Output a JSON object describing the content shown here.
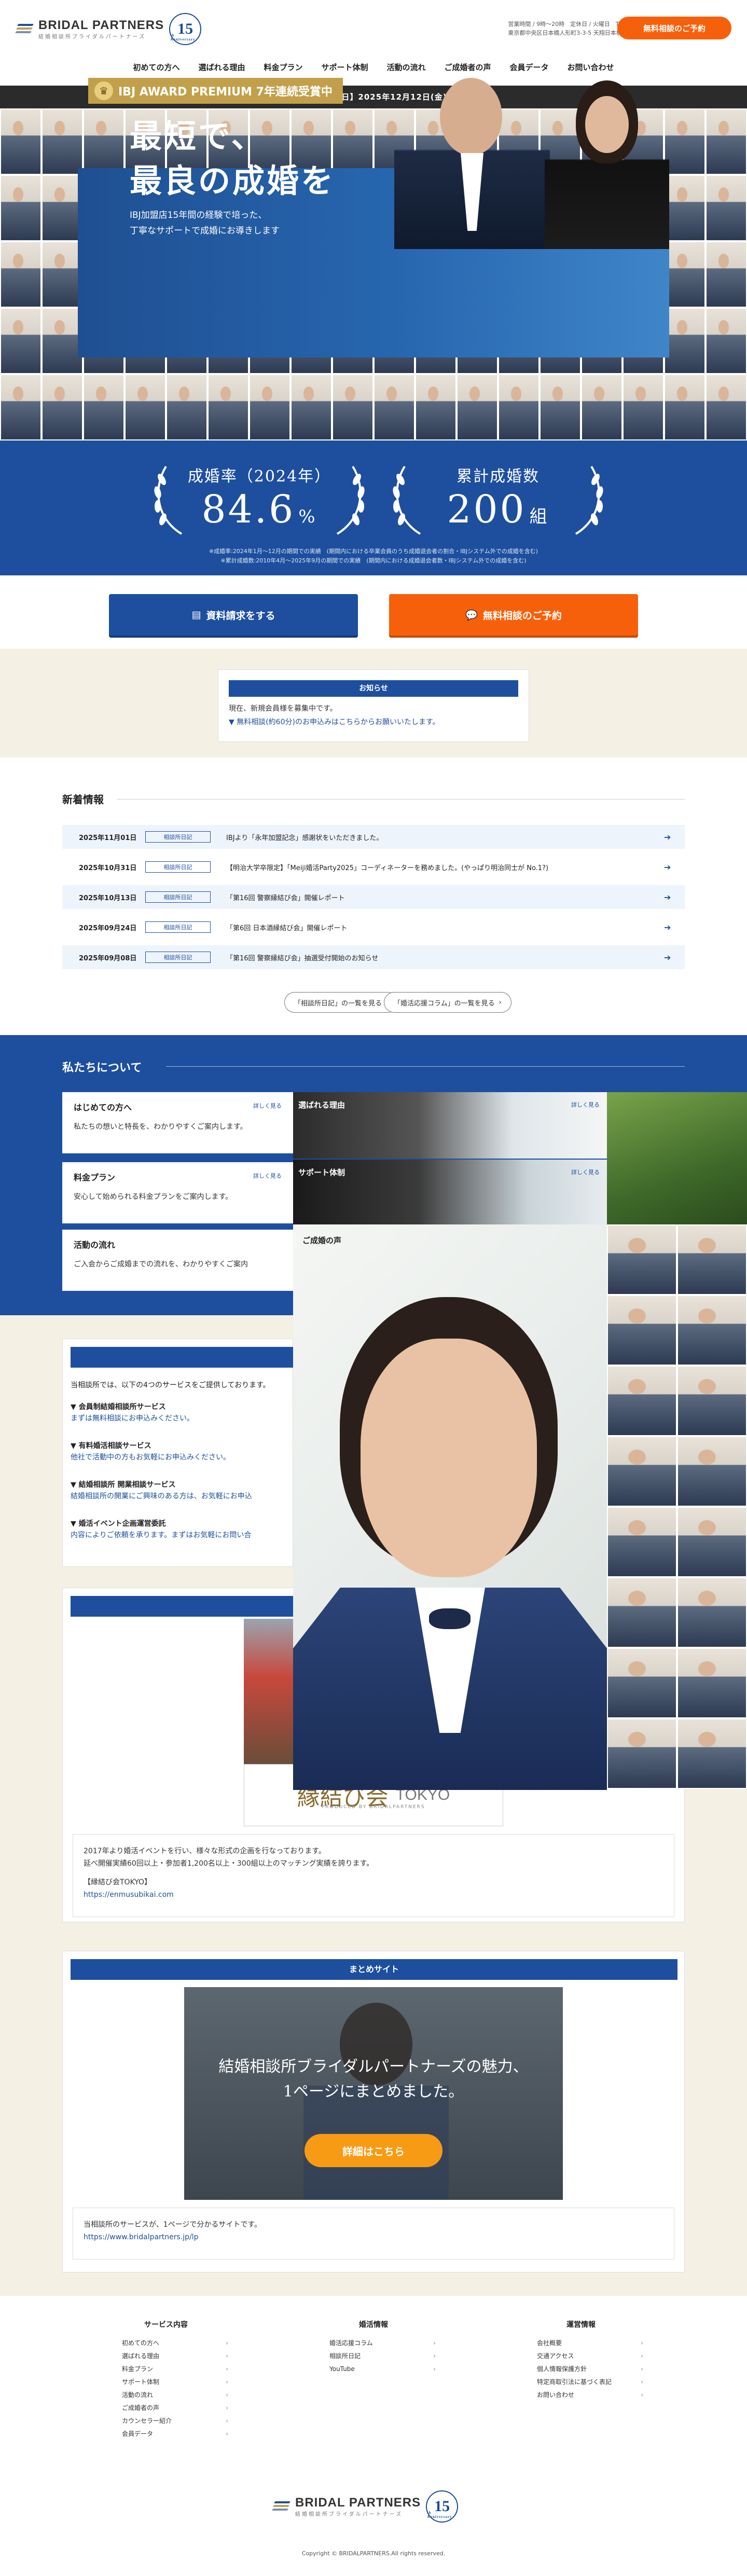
{
  "header": {
    "brand": "BRIDAL PARTNERS",
    "brand_sub": "結婚相談所ブライダルパートナーズ",
    "anniv": "15",
    "anniv_small": "th Anniversary",
    "hours": "営業時間 / 9時〜20時　定休日 / 火曜日　TEL.050-5477-7189",
    "address": "東京都中央区日本橋人形町3-3-5 天翔日本橋人形町ビル2階",
    "cta": "無料相談のご予約"
  },
  "nav": [
    "初めての方へ",
    "選ばれる理由",
    "料金プラン",
    "サポート体制",
    "活動の流れ",
    "ご成婚者の声",
    "会員データ",
    "お問い合わせ"
  ],
  "date_bar": "【最終更新日】2025年12月12日(金)",
  "hero": {
    "award": "IBJ AWARD PREMIUM 7年連続受賞中",
    "copy1": "最短で、",
    "copy2": "最良の成婚を",
    "sub1": "IBJ加盟店15年間の経験で培った、",
    "sub2": "丁寧なサポートで成婚にお導きします"
  },
  "stats": {
    "rate_label": "成婚率（2024年）",
    "rate_value": "84.6",
    "rate_unit": "%",
    "count_label": "累計成婚数",
    "count_value": "200",
    "count_unit": "組",
    "note1": "※成婚率:2024年1月〜12月の期間での実績　(期間内における卒業会員のうち成婚退会者の割合・IBJシステム外での成婚を含む)",
    "note2": "※累計成婚数:2010年4月〜2025年9月の期間での実績　(期間内における成婚退会者数・IBJシステム外での成婚を含む)"
  },
  "cta": {
    "doc": "資料請求をする",
    "consult": "無料相談のご予約"
  },
  "notice": {
    "title": "お知らせ",
    "line1": "現在、新規会員様を募集中です。",
    "line2": "▼ 無料相談(約60分)のお申込みはこちらからお願いいたします。"
  },
  "news": {
    "title": "新着情報",
    "rows": [
      {
        "date": "2025年11月01日",
        "tag": "相談所日記",
        "title": "IBJより「永年加盟記念」感謝状をいただきました。"
      },
      {
        "date": "2025年10月31日",
        "tag": "相談所日記",
        "title": "【明治大学卒限定】「Meiji婚活Party2025」コーディネーターを務めました。(やっぱり明治同士が No.1?)"
      },
      {
        "date": "2025年10月13日",
        "tag": "相談所日記",
        "title": "「第16回 警察縁結び会」開催レポート"
      },
      {
        "date": "2025年09月24日",
        "tag": "相談所日記",
        "title": "「第6回 日本酒縁結び会」開催レポート"
      },
      {
        "date": "2025年09月08日",
        "tag": "相談所日記",
        "title": "「第16回 警察縁結び会」抽選受付開始のお知らせ"
      }
    ],
    "pill1": "「相談所日記」の一覧を見る",
    "pill2": "「婚活応援コラム」の一覧を見る"
  },
  "about": {
    "title": "私たちについて",
    "more": "詳しく見る",
    "cards": [
      {
        "t": "はじめての方へ",
        "d": "私たちの想いと特長を、わかりやすくご案内します。"
      },
      {
        "t": "料金プラン",
        "d": "安心して始められる料金プランをご案内します。"
      },
      {
        "t": "活動の流れ",
        "d": "ご入会からご成婚までの流れを、わかりやすくご案内"
      }
    ],
    "photos": [
      "選ばれる理由",
      "サポート体制",
      "ご成婚の声"
    ]
  },
  "services": {
    "intro": "当相談所では、以下の4つのサービスをご提供しております。",
    "items": [
      {
        "t": "▼ 会員制結婚相談所サービス",
        "d": "まずは無料相談にお申込みください。"
      },
      {
        "t": "▼ 有料婚活相談サービス",
        "d": "他社で活動中の方もお気軽にお申込みください。"
      },
      {
        "t": "▼ 結婚相談所 開業相談サービス",
        "d": "結婚相談所の開業にご興味のある方は、お気軽にお申込"
      },
      {
        "t": "▼ 婚活イベント企画運営委託",
        "d": "内容によりご依頼を承ります。まずはお気軽にお問い合"
      }
    ]
  },
  "enmusubi": {
    "logo": "縁結び会",
    "logo_en": "TOKYO",
    "produced": "PRODUCED BY BRIDALPARTNERS",
    "l1": "2017年より婚活イベントを行い、様々な形式の企画を行なっております。",
    "l2": "延べ開催実績60回以上・参加者1,200名以上・300組以上のマッチング実績を誇ります。",
    "l3": "【縁結び会TOKYO】",
    "url": "https://enmusubikai.com"
  },
  "matome": {
    "title": "まとめサイト",
    "img1": "結婚相談所ブライダルパートナーズの魅力、",
    "img2": "1ページにまとめました。",
    "btn": "詳細はこちら",
    "l1": "当相談所のサービスが、1ページで分かるサイトです。",
    "url": "https://www.bridalpartners.jp/lp"
  },
  "footer": {
    "cols": [
      {
        "h": "サービス内容",
        "items": [
          "初めての方へ",
          "選ばれる理由",
          "料金プラン",
          "サポート体制",
          "活動の流れ",
          "ご成婚者の声",
          "カウンセラー紹介",
          "会員データ"
        ]
      },
      {
        "h": "婚活情報",
        "items": [
          "婚活応援コラム",
          "相談所日記",
          "YouTube"
        ]
      },
      {
        "h": "運営情報",
        "items": [
          "会社概要",
          "交通アクセス",
          "個人情報保護方針",
          "特定商取引法に基づく表記",
          "お問い合わせ"
        ]
      }
    ],
    "copyright": "Copyright © BRIDALPARTNERS.All rights reserved."
  },
  "colors": {
    "brand_blue": "#1d4f9e",
    "orange": "#f7600a",
    "gold": "#c2a04b",
    "cream": "#f4f0e3"
  }
}
